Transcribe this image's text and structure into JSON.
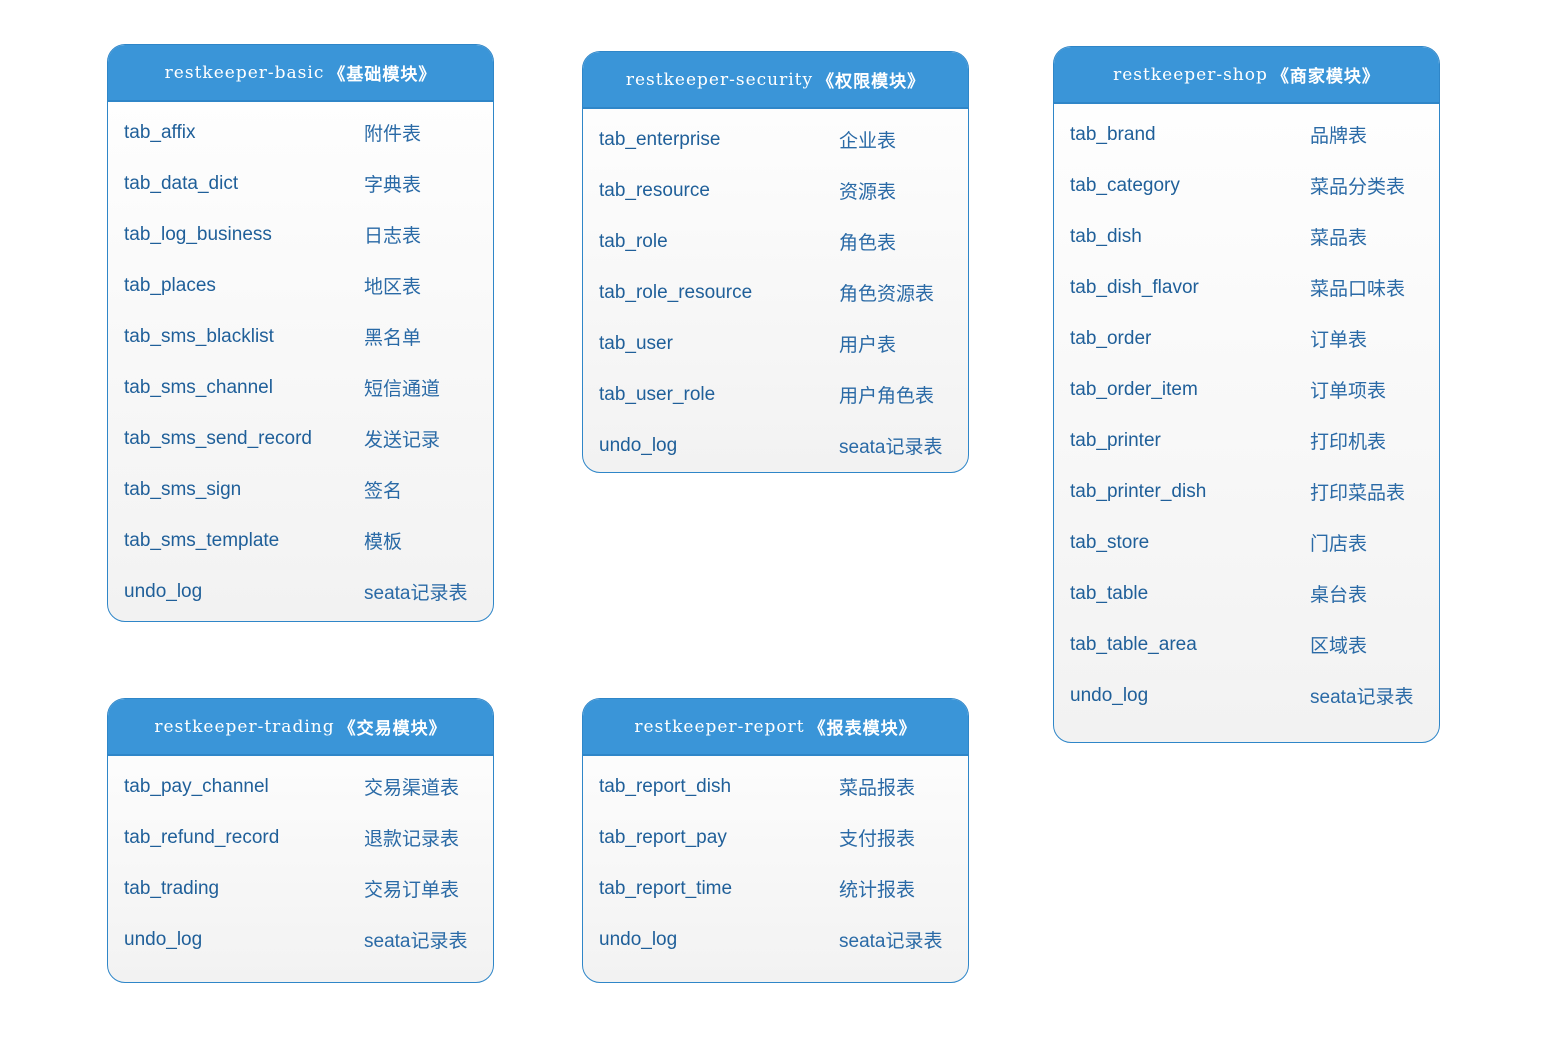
{
  "modules": {
    "basic": {
      "name": "restkeeper-basic",
      "cn": "《基础模块》",
      "rows": [
        {
          "table": "tab_affix",
          "desc": "附件表"
        },
        {
          "table": "tab_data_dict",
          "desc": "字典表"
        },
        {
          "table": "tab_log_business",
          "desc": "日志表"
        },
        {
          "table": "tab_places",
          "desc": "地区表"
        },
        {
          "table": "tab_sms_blacklist",
          "desc": "黑名单"
        },
        {
          "table": "tab_sms_channel",
          "desc": "短信通道"
        },
        {
          "table": "tab_sms_send_record",
          "desc": "发送记录"
        },
        {
          "table": "tab_sms_sign",
          "desc": "签名"
        },
        {
          "table": "tab_sms_template",
          "desc": "模板"
        },
        {
          "table": "undo_log",
          "desc": "seata记录表"
        }
      ]
    },
    "security": {
      "name": "restkeeper-security",
      "cn": "《权限模块》",
      "rows": [
        {
          "table": "tab_enterprise",
          "desc": "企业表"
        },
        {
          "table": "tab_resource",
          "desc": "资源表"
        },
        {
          "table": "tab_role",
          "desc": "角色表"
        },
        {
          "table": "tab_role_resource",
          "desc": "角色资源表"
        },
        {
          "table": "tab_user",
          "desc": "用户表"
        },
        {
          "table": "tab_user_role",
          "desc": "用户角色表"
        },
        {
          "table": "undo_log",
          "desc": "seata记录表"
        }
      ]
    },
    "shop": {
      "name": "restkeeper-shop",
      "cn": "《商家模块》",
      "rows": [
        {
          "table": "tab_brand",
          "desc": "品牌表"
        },
        {
          "table": "tab_category",
          "desc": "菜品分类表"
        },
        {
          "table": "tab_dish",
          "desc": "菜品表"
        },
        {
          "table": "tab_dish_flavor",
          "desc": "菜品口味表"
        },
        {
          "table": "tab_order",
          "desc": "订单表"
        },
        {
          "table": "tab_order_item",
          "desc": "订单项表"
        },
        {
          "table": "tab_printer",
          "desc": "打印机表"
        },
        {
          "table": "tab_printer_dish",
          "desc": "打印菜品表"
        },
        {
          "table": "tab_store",
          "desc": "门店表"
        },
        {
          "table": "tab_table",
          "desc": "桌台表"
        },
        {
          "table": "tab_table_area",
          "desc": "区域表"
        },
        {
          "table": "undo_log",
          "desc": "seata记录表"
        }
      ]
    },
    "trading": {
      "name": "restkeeper-trading",
      "cn": "《交易模块》",
      "rows": [
        {
          "table": "tab_pay_channel",
          "desc": "交易渠道表"
        },
        {
          "table": "tab_refund_record",
          "desc": "退款记录表"
        },
        {
          "table": "tab_trading",
          "desc": "交易订单表"
        },
        {
          "table": "undo_log",
          "desc": "seata记录表"
        }
      ]
    },
    "report": {
      "name": "restkeeper-report",
      "cn": "《报表模块》",
      "rows": [
        {
          "table": "tab_report_dish",
          "desc": "菜品报表"
        },
        {
          "table": "tab_report_pay",
          "desc": "支付报表"
        },
        {
          "table": "tab_report_time",
          "desc": "统计报表"
        },
        {
          "table": "undo_log",
          "desc": "seata记录表"
        }
      ]
    }
  },
  "colors": {
    "header_bg": "#3a95d8",
    "border": "#2f86c8",
    "text": "#1f5f99"
  }
}
